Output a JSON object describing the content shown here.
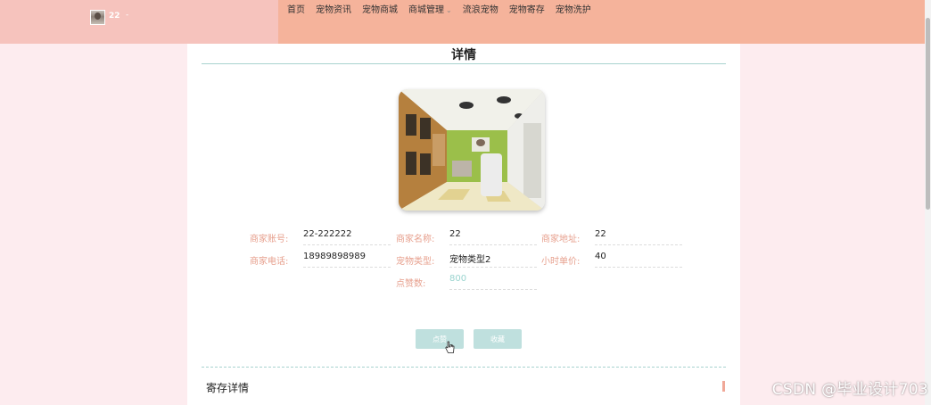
{
  "header": {
    "username": "22",
    "user_caret": "-",
    "nav": [
      {
        "label": "首页"
      },
      {
        "label": "宠物资讯"
      },
      {
        "label": "宠物商城"
      },
      {
        "label": "商城管理",
        "has_caret": true
      },
      {
        "label": "流浪宠物"
      },
      {
        "label": "宠物寄存"
      },
      {
        "label": "宠物洗护"
      }
    ],
    "colors": {
      "left": "#f6c3bd",
      "right": "#f5b39b"
    }
  },
  "page": {
    "title": "详情",
    "fields": {
      "account": {
        "label": "商家账号:",
        "value": "22-222222"
      },
      "name": {
        "label": "商家名称:",
        "value": "22"
      },
      "address": {
        "label": "商家地址:",
        "value": "22"
      },
      "phone": {
        "label": "商家电话:",
        "value": "18989898989"
      },
      "pet_type": {
        "label": "宠物类型:",
        "value": "宠物类型2"
      },
      "hourly_price": {
        "label": "小时单价:",
        "value": "40"
      },
      "likes": {
        "label": "点赞数:",
        "value": "800"
      }
    },
    "buttons": {
      "like": "点赞",
      "favorite": "收藏"
    },
    "section_title": "寄存详情",
    "accent": "#bfe0de"
  },
  "watermark": "CSDN @毕业设计703"
}
